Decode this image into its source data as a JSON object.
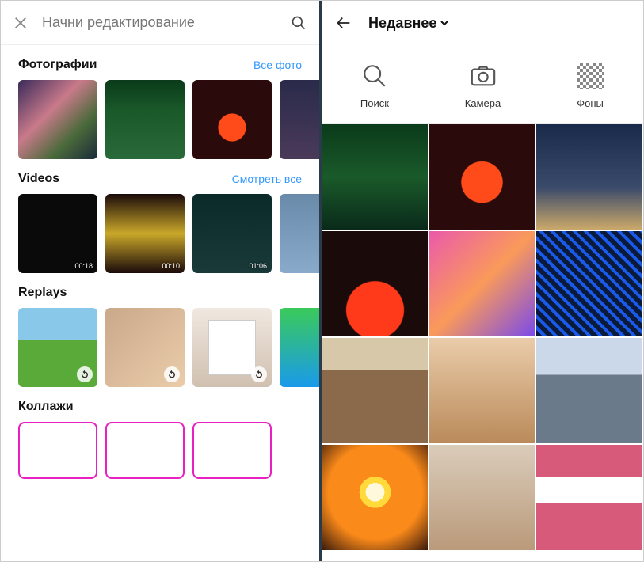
{
  "left": {
    "header_placeholder": "Начни редактирование",
    "sections": {
      "photos": {
        "title": "Фотографии",
        "link": "Все фото"
      },
      "videos": {
        "title": "Videos",
        "link": "Смотреть все",
        "durations": [
          "00:18",
          "00:10",
          "01:06"
        ]
      },
      "replays": {
        "title": "Replays"
      },
      "collages": {
        "title": "Коллажи"
      }
    }
  },
  "right": {
    "dropdown": "Недавнее",
    "actions": {
      "search": "Поиск",
      "camera": "Камера",
      "bg": "Фоны"
    }
  }
}
